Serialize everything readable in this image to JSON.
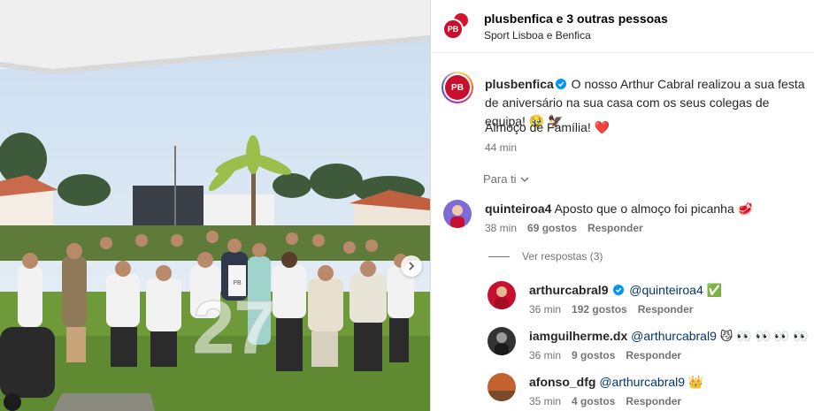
{
  "post": {
    "author": "plusbenfica",
    "header_others": " e 3 outras pessoas",
    "header_sub": "Sport Lisboa e Benfica",
    "logo_text": "PB",
    "cake_number": "27",
    "caption_text": " O nosso Arthur Cabral realizou a sua festa de aniversário na sua casa com os seus colegas de equipa! 🥹 🦅",
    "caption_line2": "Almoço de Família! ❤️",
    "caption_time": "44 min",
    "filter_label": "Para ti"
  },
  "comments": [
    {
      "user": "quinteiroa4",
      "text": "Aposto que o almoço foi picanha 🥩",
      "time": "38 min",
      "likes": "69 gostos",
      "reply": "Responder",
      "avatar_color": "#6a5acd"
    }
  ],
  "replies_toggle": "Ver respostas (3)",
  "replies": [
    {
      "user": "arthurcabral9",
      "mention": "@quinteiroa4",
      "suffix": " ✅",
      "verified": true,
      "time": "36 min",
      "likes": "192 gostos",
      "reply": "Responder",
      "avatar_color": "#c8102e"
    },
    {
      "user": "iamguilherme.dx",
      "mention": "@arthurcabral9",
      "suffix": " 😼 👀 👀 👀 👀 🔥",
      "verified": false,
      "time": "36 min",
      "likes": "9 gostos",
      "reply": "Responder",
      "avatar_color": "#333333"
    },
    {
      "user": "afonso_dfg",
      "mention": "@arthurcabral9",
      "suffix": " 👑",
      "verified": false,
      "time": "35 min",
      "likes": "4 gostos",
      "reply": "Responder",
      "avatar_color": "#c4622d"
    }
  ],
  "colors": {
    "brand_red": "#c8102e",
    "verified_blue": "#0095f6",
    "mention_blue": "#00376b",
    "muted": "#737373"
  }
}
